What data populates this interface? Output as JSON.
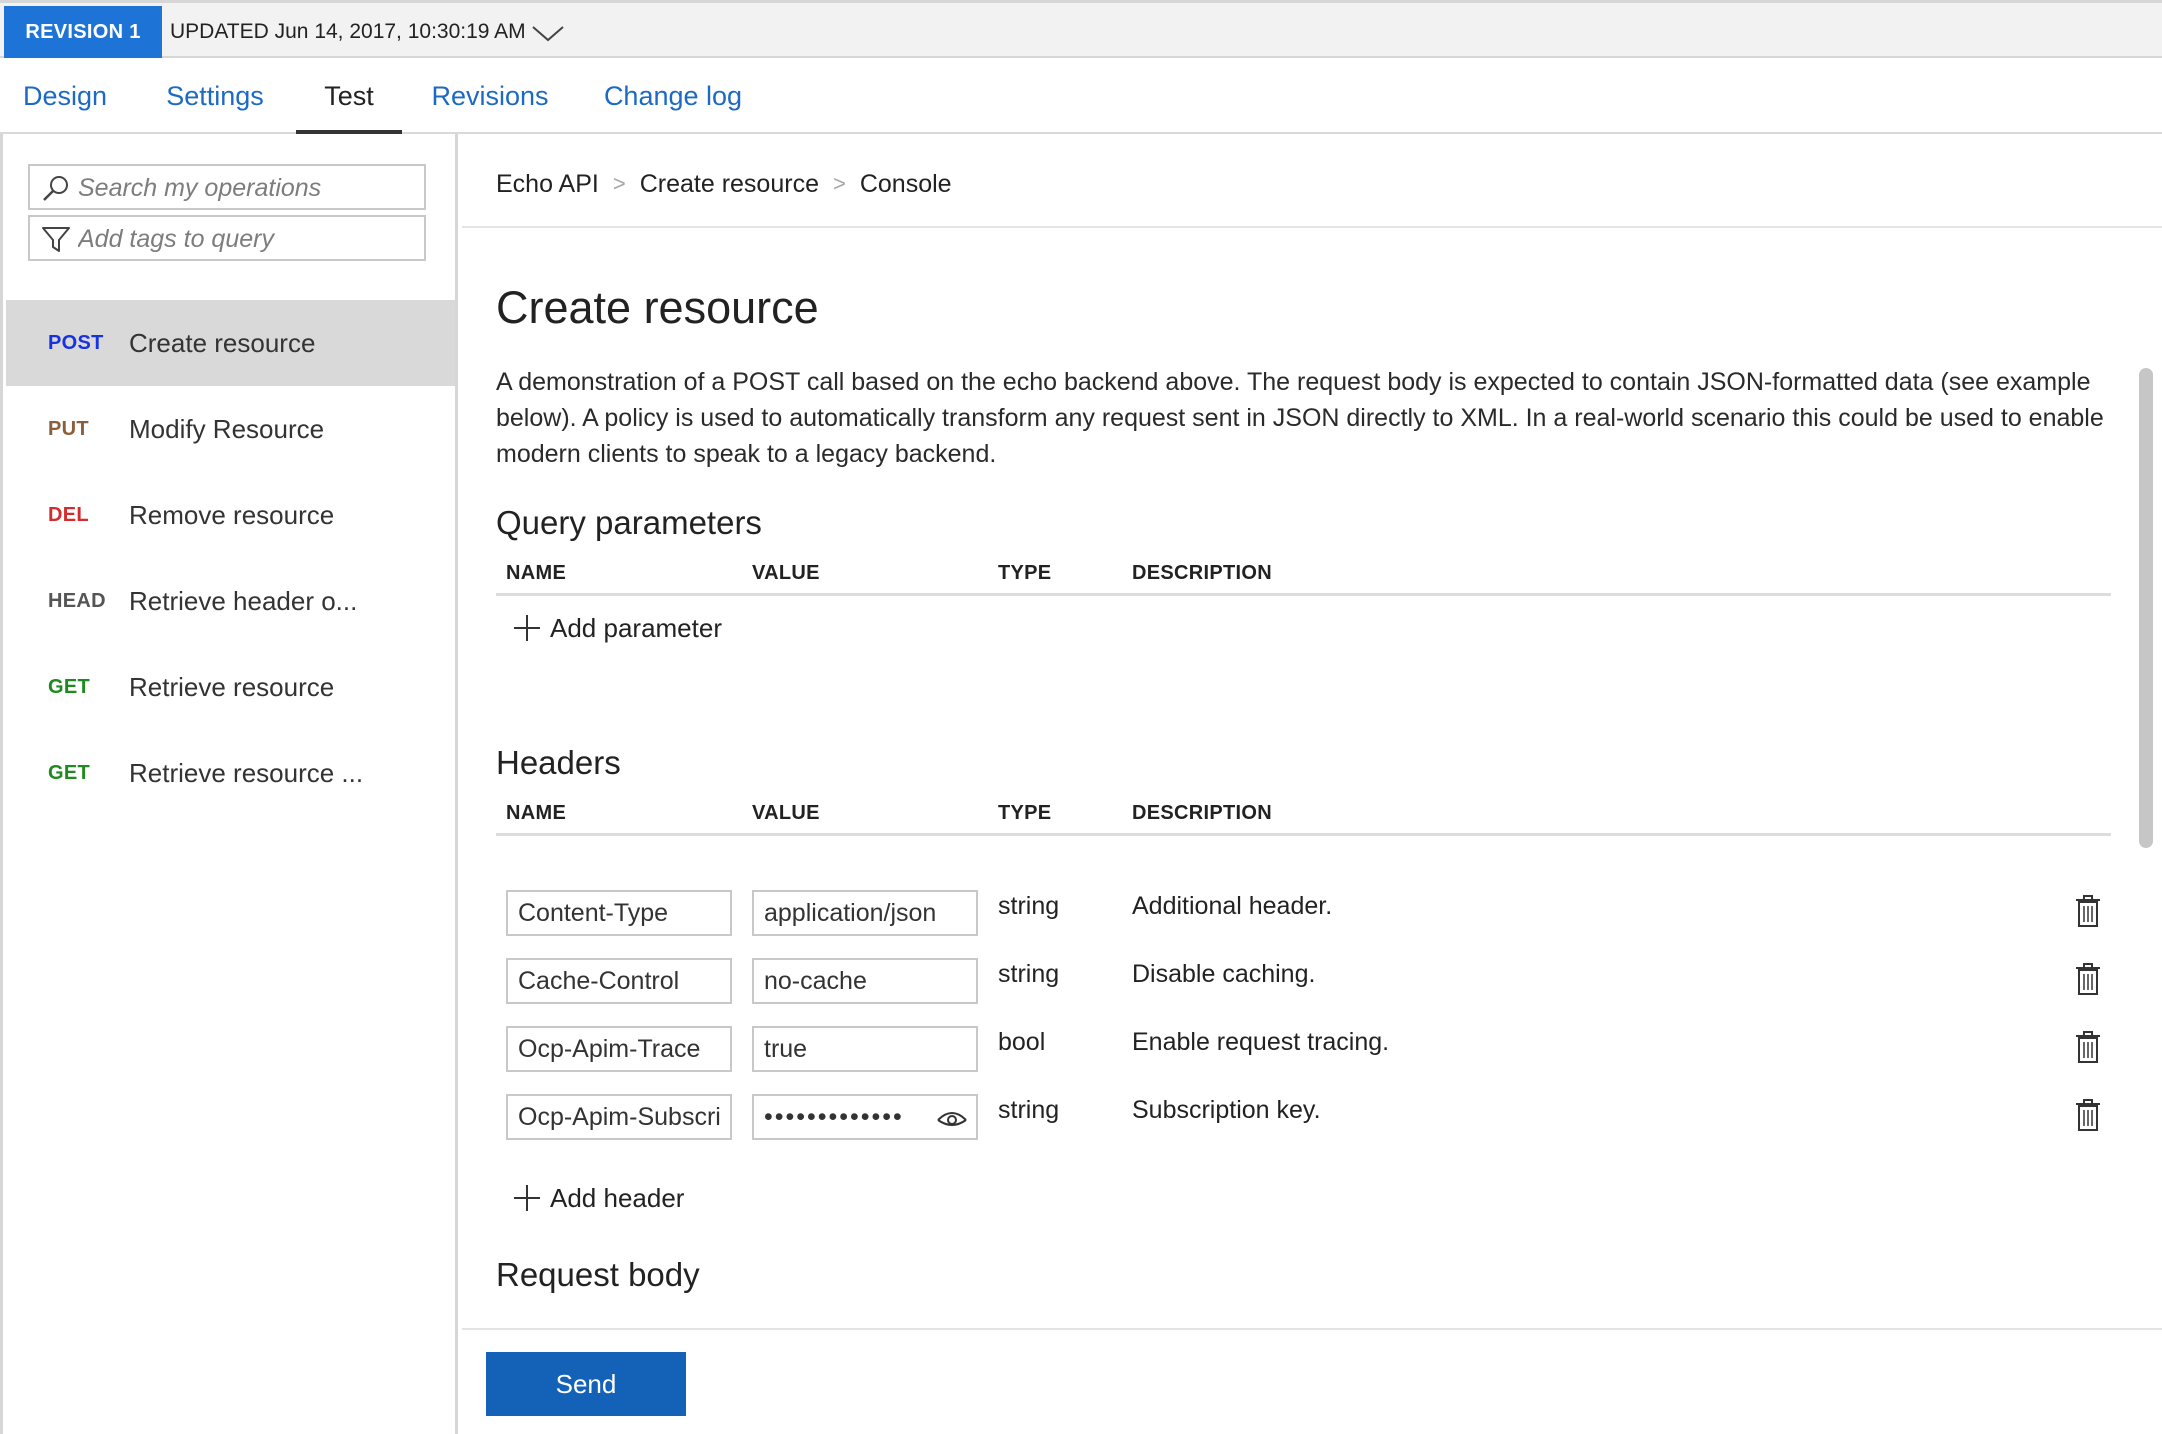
{
  "revision": {
    "badge": "REVISION 1",
    "updated": "UPDATED Jun 14, 2017, 10:30:19 AM",
    "chevron_icon": "chevron-down-icon"
  },
  "tabs": [
    {
      "label": "Design"
    },
    {
      "label": "Settings"
    },
    {
      "label": "Test",
      "active": true
    },
    {
      "label": "Revisions"
    },
    {
      "label": "Change log"
    }
  ],
  "sidebar": {
    "search_placeholder": "Search my operations",
    "tags_placeholder": "Add tags to query",
    "operations": [
      {
        "method": "POST",
        "name": "Create resource",
        "color": "#1732e0",
        "selected": true
      },
      {
        "method": "PUT",
        "name": "Modify Resource",
        "color": "#8b5e3c"
      },
      {
        "method": "DEL",
        "name": "Remove resource",
        "color": "#d42c2c"
      },
      {
        "method": "HEAD",
        "name": "Retrieve header o...",
        "color": "#555555"
      },
      {
        "method": "GET",
        "name": "Retrieve resource",
        "color": "#1f8a1f"
      },
      {
        "method": "GET",
        "name": "Retrieve resource ...",
        "color": "#1f8a1f"
      }
    ]
  },
  "breadcrumb": [
    "Echo API",
    "Create resource",
    "Console"
  ],
  "operation": {
    "title": "Create resource",
    "description": "A demonstration of a POST call based on the echo backend above. The request body is expected to contain JSON-formatted data (see example below). A policy is used to automatically transform any request sent in JSON directly to XML. In a real-world scenario this could be used to enable modern clients to speak to a legacy backend."
  },
  "query_parameters": {
    "heading": "Query parameters",
    "columns": {
      "name": "NAME",
      "value": "VALUE",
      "type": "TYPE",
      "description": "DESCRIPTION"
    },
    "add_label": "Add parameter"
  },
  "headers": {
    "heading": "Headers",
    "columns": {
      "name": "NAME",
      "value": "VALUE",
      "type": "TYPE",
      "description": "DESCRIPTION"
    },
    "rows": [
      {
        "name": "Content-Type",
        "value": "application/json",
        "type": "string",
        "description": "Additional header."
      },
      {
        "name": "Cache-Control",
        "value": "no-cache",
        "type": "string",
        "description": "Disable caching."
      },
      {
        "name": "Ocp-Apim-Trace",
        "value": "true",
        "type": "bool",
        "description": "Enable request tracing."
      },
      {
        "name": "Ocp-Apim-Subscription-Key",
        "value": "•••••••••••••",
        "type": "string",
        "description": "Subscription key.",
        "masked": true
      }
    ],
    "add_label": "Add header"
  },
  "request_body": {
    "heading": "Request body"
  },
  "send_label": "Send",
  "colors": {
    "accent": "#1e74d6",
    "link": "#1c6ac4",
    "send": "#1462b8",
    "selected_bg": "#d9d9d9"
  }
}
